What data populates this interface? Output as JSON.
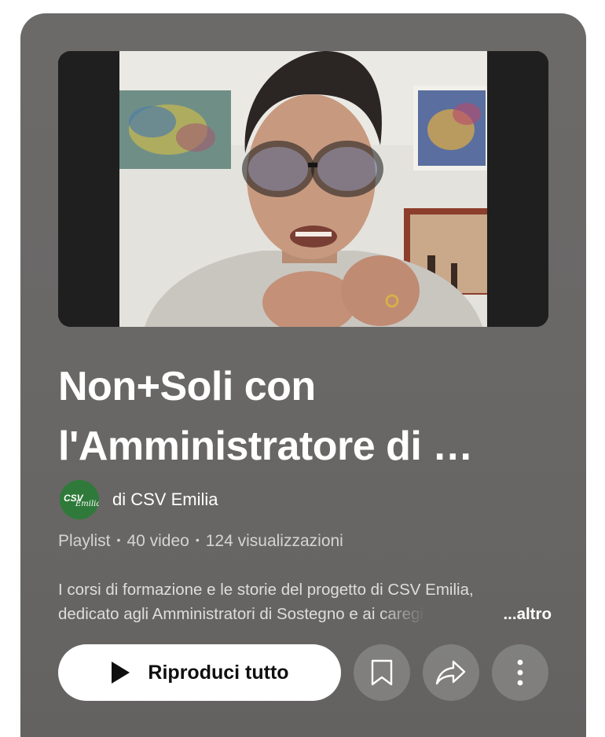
{
  "playlist": {
    "title_line1": "Non+Soli con",
    "title_line2": "l'Amministratore di …",
    "owner": {
      "avatar_text": "CSV Emilia",
      "name": "di CSV Emilia"
    },
    "meta": {
      "type": "Playlist",
      "video_count": "40 video",
      "views": "124 visualizzazioni"
    },
    "description": {
      "line1": "I corsi di formazione e le storie del progetto di CSV Emilia,",
      "line2_visible": "dedicato agli Amministratori di Sostegno e ai ",
      "line2_fading": "caregi",
      "more_label": "...altro"
    },
    "actions": {
      "play_all_label": "Riproduci tutto",
      "save_icon": "bookmark-icon",
      "share_icon": "share-icon",
      "more_icon": "more-vertical-icon"
    }
  },
  "colors": {
    "card_background": "#6a6867",
    "play_button_bg": "#ffffff",
    "avatar_bg": "#2f7a3a"
  }
}
